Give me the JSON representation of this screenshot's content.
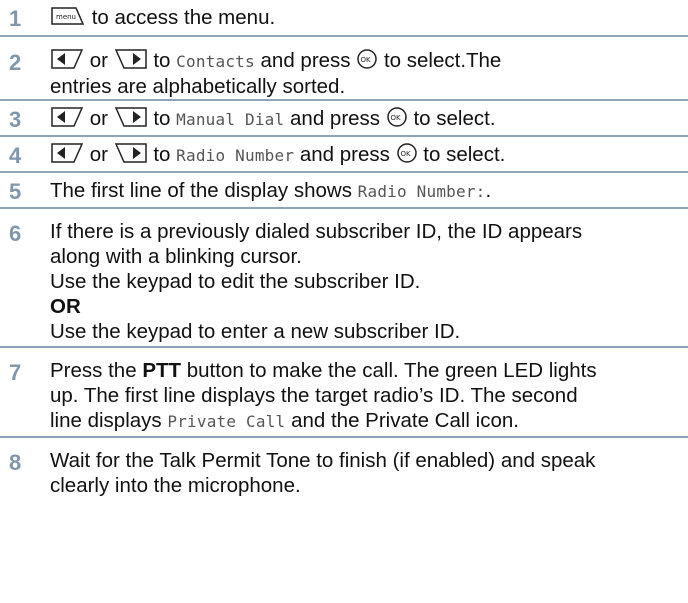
{
  "steps": [
    {
      "number": "1",
      "text_a": "to access the menu.",
      "menu_key_label": "menu"
    },
    {
      "number": "2",
      "or": "or",
      "to": "to",
      "target": "Contacts",
      "and_press": "and press",
      "select": "to select.The",
      "line2": "entries are alphabetically sorted."
    },
    {
      "number": "3",
      "or": "or",
      "to": "to",
      "target": "Manual Dial",
      "and_press": "and press",
      "select": "to select."
    },
    {
      "number": "4",
      "or": "or",
      "to": "to",
      "target": "Radio Number",
      "and_press": "and press",
      "select": "to select."
    },
    {
      "number": "5",
      "text_a": "The first line of the display shows",
      "mono": "Radio Number:",
      "text_b": "."
    },
    {
      "number": "6",
      "line1": "If there is a previously dialed subscriber ID, the ID appears",
      "line2": "along with a blinking cursor.",
      "line3": "Use the keypad to edit the subscriber ID.",
      "line4": "OR",
      "line5": "Use the keypad to enter a new subscriber ID."
    },
    {
      "number": "7",
      "l1a": "Press the",
      "l1b": "PTT",
      "l1c": "button to make the call. The green LED lights",
      "line2": "up. The first line displays the target radio’s ID. The second",
      "l3a": "line displays",
      "l3mono": "Private Call",
      "l3b": "and the Private Call icon."
    },
    {
      "number": "8",
      "line1": "Wait for the Talk Permit Tone to finish (if enabled) and speak",
      "line2": "clearly into the microphone."
    }
  ],
  "icons": {
    "menu_key": "menu-key-icon",
    "left_arrow_key": "left-arrow-key-icon",
    "right_arrow_key": "right-arrow-key-icon",
    "ok_key": "ok-button-icon"
  },
  "colors": {
    "step_number": "#7f97ac",
    "divider": "#8fa3b4",
    "mono_text": "#555555"
  }
}
